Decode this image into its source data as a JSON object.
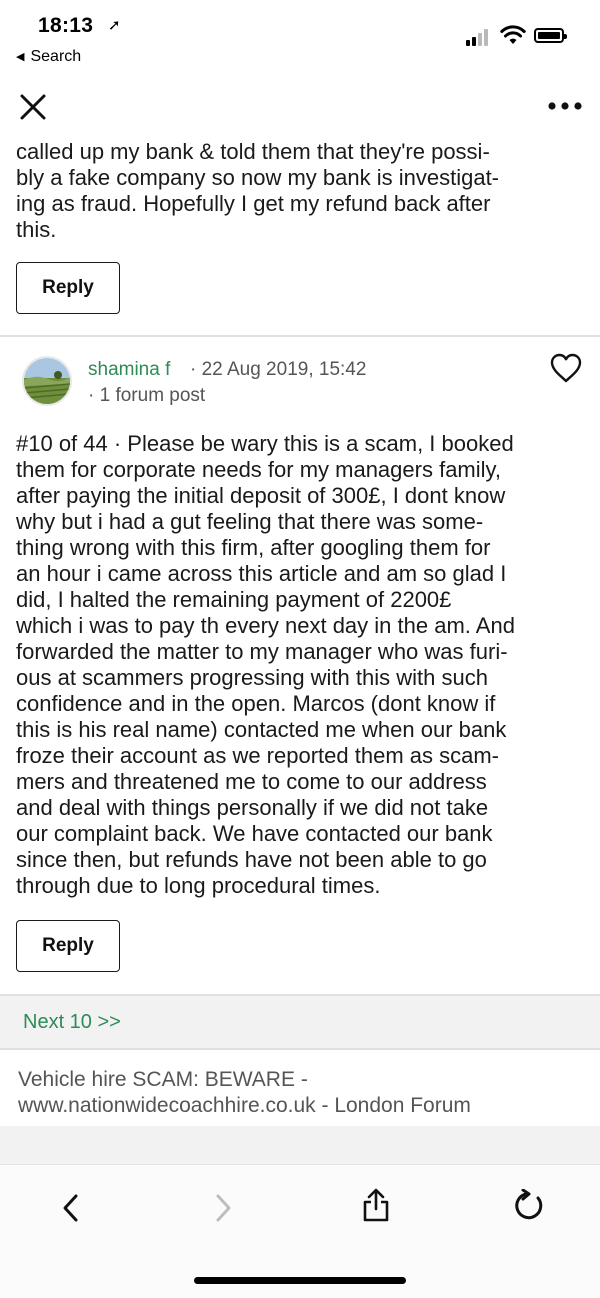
{
  "status_bar": {
    "time": "18:13",
    "back_app": "Search"
  },
  "previous_post": {
    "text": "called up my bank & told them that they're possi-\nbly a fake company so now my bank is investigat-\ning as fraud. Hopefully I get my refund back after\nthis.",
    "reply_label": "Reply"
  },
  "post": {
    "author": "shamina f",
    "date": "· 22 Aug 2019, 15:42",
    "forum_posts": "· 1 forum post",
    "text": "#10 of 44 ·  Please be wary this is a scam, I booked\nthem for corporate needs for my managers family,\nafter paying the initial deposit of 300£, I dont know\nwhy but i had a gut feeling that there was some-\nthing wrong with this firm, after googling them for\nan hour i came across this article and am so glad I\ndid, I halted the remaining payment of 2200£\nwhich i was to pay th every next day in the am. And\nforwarded the matter to my manager who was furi-\nous at scammers progressing with this with such\nconfidence and in the open. Marcos (dont know if\nthis is his real name) contacted me when our bank\nfroze their account as we reported them as scam-\nmers and threatened me to come to our address\nand deal with things personally if we did not take\nour complaint back. We have contacted our bank\nsince then, but refunds have not been able to go\nthrough due to long procedural times.",
    "reply_label": "Reply"
  },
  "pagination": {
    "next_label": "Next 10 >>"
  },
  "thread": {
    "title": "Vehicle hire SCAM: BEWARE -\nwww.nationwidecoachhire.co.uk - London Forum"
  },
  "colors": {
    "accent_green": "#2e8b57",
    "text_gray": "#555555"
  },
  "icons": {
    "close": "close-icon",
    "more": "more-icon",
    "heart": "heart-icon",
    "back": "chevron-left-icon",
    "forward": "chevron-right-icon",
    "share": "share-icon",
    "refresh": "refresh-icon"
  }
}
